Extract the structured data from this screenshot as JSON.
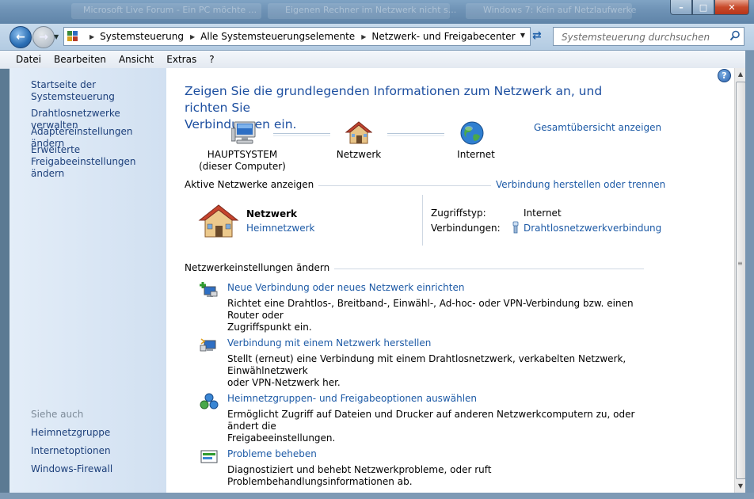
{
  "titlebar": {
    "ghost_tabs": [
      "Microsoft Live Forum - Ein PC möchte ...",
      "Eigenen Rechner im Netzwerk nicht s...",
      "Windows 7: Kein auf Netzlaufwerke"
    ],
    "controls": {
      "minimize": "–",
      "maximize": "□",
      "close": "✕"
    }
  },
  "navbar": {
    "back_icon": "back-arrow-icon",
    "forward_icon": "forward-arrow-icon",
    "breadcrumbs": [
      "Systemsteuerung",
      "Alle Systemsteuerungselemente",
      "Netzwerk- und Freigabecenter"
    ],
    "search_placeholder": "Systemsteuerung durchsuchen"
  },
  "menubar": [
    "Datei",
    "Bearbeiten",
    "Ansicht",
    "Extras",
    "?"
  ],
  "sidebar": {
    "home": "Startseite der Systemsteuerung",
    "links": [
      "Drahtlosnetzwerke verwalten",
      "Adaptereinstellungen ändern",
      "Erweiterte",
      "Freigabeeinstellungen ändern"
    ],
    "see_also_label": "Siehe auch",
    "see_also": [
      "Heimnetzgruppe",
      "Internetoptionen",
      "Windows-Firewall"
    ]
  },
  "main": {
    "heading_line1": "Zeigen Sie die grundlegenden Informationen zum Netzwerk an, und richten Sie",
    "heading_line2": "Verbindungen ein.",
    "overview_link": "Gesamtübersicht anzeigen",
    "map": {
      "computer_line1": "HAUPTSYSTEM",
      "computer_line2": "(dieser Computer)",
      "network": "Netzwerk",
      "internet": "Internet"
    },
    "active_section": "Aktive Netzwerke anzeigen",
    "connect_link": "Verbindung herstellen oder trennen",
    "active_network": {
      "name": "Netzwerk",
      "type_link": "Heimnetzwerk",
      "access_label": "Zugriffstyp:",
      "access_value": "Internet",
      "connections_label": "Verbindungen:",
      "connections_value": "Drahtlosnetzwerkverbindung"
    },
    "settings_section": "Netzwerkeinstellungen ändern",
    "tasks": [
      {
        "title": "Neue Verbindung oder neues Netzwerk einrichten",
        "desc1": "Richtet eine Drahtlos-, Breitband-, Einwähl-, Ad-hoc- oder VPN-Verbindung bzw. einen Router oder",
        "desc2": "Zugriffspunkt ein."
      },
      {
        "title": "Verbindung mit einem Netzwerk herstellen",
        "desc1": "Stellt (erneut) eine Verbindung mit einem Drahtlosnetzwerk, verkabelten Netzwerk, Einwählnetzwerk",
        "desc2": "oder VPN-Netzwerk her."
      },
      {
        "title": "Heimnetzgruppen- und Freigabeoptionen auswählen",
        "desc1": "Ermöglicht Zugriff auf Dateien und Drucker auf anderen Netzwerkcomputern zu, oder ändert die",
        "desc2": "Freigabeeinstellungen."
      },
      {
        "title": "Probleme beheben",
        "desc1": "Diagnostiziert und behebt Netzwerkprobleme, oder ruft Problembehandlungsinformationen ab.",
        "desc2": ""
      }
    ]
  },
  "colors": {
    "link": "#1d5aa6",
    "heading": "#1d4fa0",
    "sidebar_bg": "#dbe7f5"
  }
}
